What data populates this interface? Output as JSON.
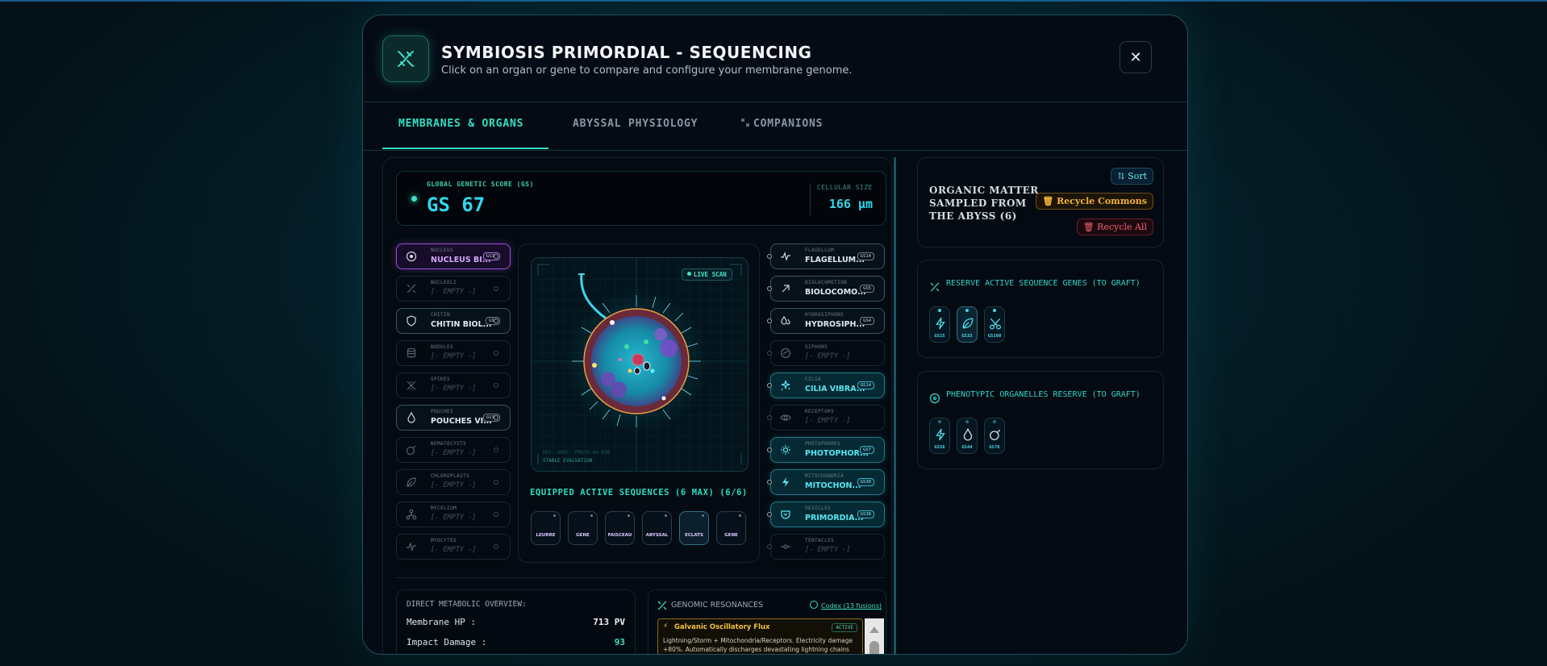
{
  "header": {
    "title": "SYMBIOSIS PRIMORDIAL - SEQUENCING",
    "subtitle": "Click on an organ or gene to compare and configure your membrane genome."
  },
  "tabs": [
    {
      "label": "MEMBRANES & ORGANS"
    },
    {
      "label": "ABYSSAL PHYSIOLOGY"
    },
    {
      "label": "COMPANIONS"
    }
  ],
  "score": {
    "label": "GLOBAL GENETIC SCORE (GS)",
    "value": "GS 67",
    "size_label": "CELLULAR SIZE",
    "size_value": "166 µm"
  },
  "left_slots": [
    {
      "label": "NUCLEUS",
      "value": "NUCLEUS BI...",
      "badge": "GS38"
    },
    {
      "label": "NUCLEOLI",
      "value": "[- EMPTY -]"
    },
    {
      "label": "CHITIN",
      "value": "CHITIN BIOL...",
      "badge": "GS5"
    },
    {
      "label": "NODULES",
      "value": "[- EMPTY -]"
    },
    {
      "label": "SPIKES",
      "value": "[- EMPTY -]"
    },
    {
      "label": "POUCHES",
      "value": "POUCHES VI...",
      "badge": "GS38"
    },
    {
      "label": "NEMATOCYSTS",
      "value": "[- EMPTY -]"
    },
    {
      "label": "CHLOROPLASTS",
      "value": "[- EMPTY -]"
    },
    {
      "label": "MYCELIUM",
      "value": "[- EMPTY -]"
    },
    {
      "label": "MYOCYTES",
      "value": "[- EMPTY -]"
    }
  ],
  "right_slots": [
    {
      "label": "FLAGELLUM",
      "value": "FLAGELLUM...",
      "badge": "GS14"
    },
    {
      "label": "BIOLOCOMOTION",
      "value": "BIOLOCOMO...",
      "badge": "GS5"
    },
    {
      "label": "HYDROSIPHONS",
      "value": "HYDROSIPH...",
      "badge": "GS4"
    },
    {
      "label": "SIPHONS",
      "value": "[- EMPTY -]"
    },
    {
      "label": "CILIA",
      "value": "CILIA VIBRA...",
      "badge": "GS14"
    },
    {
      "label": "RECEPTORS",
      "value": "[- EMPTY -]"
    },
    {
      "label": "PHOTOPHORES",
      "value": "PHOTOPHOR...",
      "badge": "GS7"
    },
    {
      "label": "MITOCHONDRIA",
      "value": "MITOCHON...",
      "badge": "GS30"
    },
    {
      "label": "VESICLES",
      "value": "PRIMORDIA...",
      "badge": "GS38"
    },
    {
      "label": "TENTACLES",
      "value": "[- EMPTY -]"
    }
  ],
  "scan": {
    "live": "LIVE SCAN",
    "note1": "REF. SPEC. PROTO-49-ESB",
    "note2": "STABLE EVALUATION"
  },
  "sequences": {
    "title": "EQUIPPED ACTIVE SEQUENCES (6 MAX) (6/6)",
    "items": [
      "LEURRE",
      "GENE",
      "FAISCEAU",
      "ABYSSAL",
      "ECLATS",
      "GENE"
    ]
  },
  "metabolic": {
    "title": "DIRECT METABOLIC OVERVIEW:",
    "rows": [
      {
        "k": "Membrane HP :",
        "v": "713 PV",
        "color": "#f1f4f6"
      },
      {
        "k": "Impact Damage :",
        "v": "93",
        "color": "#3ee0c0"
      }
    ]
  },
  "resonances": {
    "title": "GENOMIC RESONANCES",
    "codex": "Codex (13 fusions)",
    "card": {
      "title": "Galvanic Oscillatory Flux",
      "status": "ACTIVE",
      "desc": "Lightning/Storm + Mitochondria/Receptors. Electricity damage +80%. Automatically discharges devastating lightning chains every"
    }
  },
  "organic": {
    "title": "ORGANIC MATTER SAMPLED FROM THE ABYSS (6)",
    "sort": "Sort",
    "recycle_commons": "Recycle Commons",
    "recycle_all": "Recycle All"
  },
  "reserve_genes": {
    "title": "RESERVE ACTIVE SEQUENCE GENES (TO GRAFT)",
    "items": [
      {
        "label": "GS15",
        "icon": "bolt-icon"
      },
      {
        "label": "GS33",
        "icon": "leaf-icon"
      },
      {
        "label": "GS100",
        "icon": "scissors-icon"
      }
    ]
  },
  "reserve_organelles": {
    "title": "PHENOTYPIC ORGANELLES RESERVE (TO GRAFT)",
    "items": [
      {
        "label": "GS56",
        "icon": "bolt-icon"
      },
      {
        "label": "GS44",
        "icon": "drop-icon"
      },
      {
        "label": "GS76",
        "icon": "bomb-icon"
      }
    ]
  },
  "colors": {
    "accent": "#32e0c4",
    "cyan": "#31d7ec",
    "purple": "#9b4ed9",
    "gold": "#f2b23a",
    "red": "#f0606c"
  }
}
